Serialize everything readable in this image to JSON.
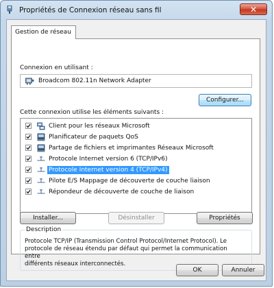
{
  "window": {
    "title": "Propriétés de Connexion réseau sans fil",
    "close_glyph": "✕"
  },
  "tabs": [
    {
      "label": "Gestion de réseau",
      "selected": true
    }
  ],
  "connect_using": {
    "label": "Connexion en utilisant :",
    "adapter": "Broadcom 802.11n Network Adapter",
    "configure_button": "Configurer..."
  },
  "items_section": {
    "label": "Cette connexion utilise les éléments suivants :",
    "items": [
      {
        "label": "Client pour les réseaux Microsoft",
        "checked": true,
        "icon": "network-client-icon",
        "selected": false
      },
      {
        "label": "Planificateur de paquets QoS",
        "checked": true,
        "icon": "service-icon",
        "selected": false
      },
      {
        "label": "Partage de fichiers et imprimantes Réseaux Microsoft",
        "checked": true,
        "icon": "service-icon",
        "selected": false
      },
      {
        "label": "Protocole Internet version 6 (TCP/IPv6)",
        "checked": true,
        "icon": "protocol-icon",
        "selected": false
      },
      {
        "label": "Protocole Internet version 4 (TCP/IPv4)",
        "checked": true,
        "icon": "protocol-icon",
        "selected": true
      },
      {
        "label": "Pilote E/S Mappage de découverte de couche liaison",
        "checked": true,
        "icon": "protocol-icon",
        "selected": false
      },
      {
        "label": "Répondeur de découverte de couche de liaison",
        "checked": true,
        "icon": "protocol-icon",
        "selected": false
      }
    ]
  },
  "actions": {
    "install": "Installer...",
    "uninstall": "Désinstaller",
    "properties": "Propriétés"
  },
  "description": {
    "legend": "Description",
    "lines": [
      "Protocole TCP/IP (Transmission Control Protocol/Internet Protocol). Le",
      "protocole de réseau étendu par défaut qui permet la communication entre",
      "différents réseaux interconnectés."
    ]
  },
  "footer": {
    "ok": "OK",
    "cancel": "Annuler"
  },
  "colors": {
    "selection": "#3399ff",
    "close_button": "#c2391f",
    "title_bar": "#c5d8ea"
  }
}
